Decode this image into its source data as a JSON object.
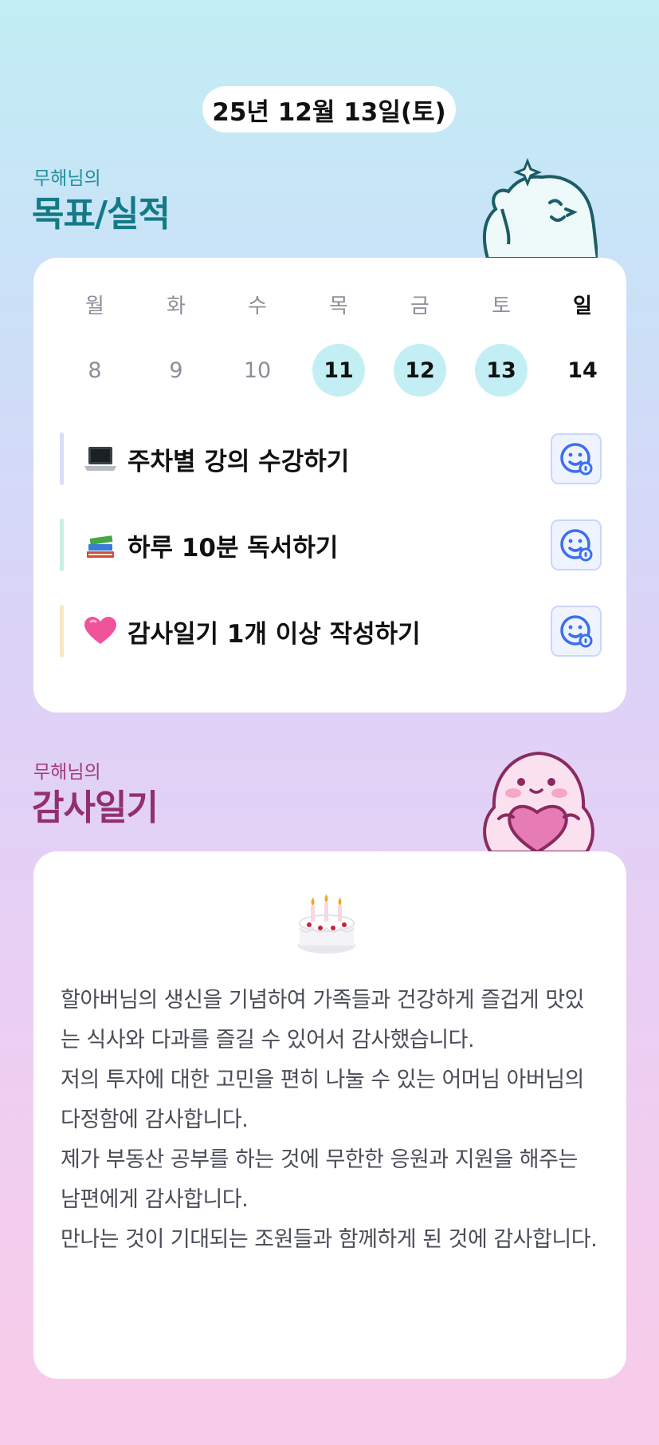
{
  "date_label": "25년 12월 13일(토)",
  "goals_section": {
    "subtitle": "무해님의",
    "title": "목표/실적"
  },
  "week": {
    "days": [
      "월",
      "화",
      "수",
      "목",
      "금",
      "토",
      "일"
    ],
    "dates": [
      "8",
      "9",
      "10",
      "11",
      "12",
      "13",
      "14"
    ],
    "completed": [
      false,
      false,
      false,
      true,
      true,
      true,
      false
    ],
    "today_index": 6
  },
  "goals": [
    {
      "emoji": "laptop-icon",
      "label": "주차별 강의 수강하기",
      "accent": "#d8defa"
    },
    {
      "emoji": "books-icon",
      "label": "하루 10분 독서하기",
      "accent": "#c8f0de"
    },
    {
      "emoji": "pink-heart-icon",
      "label": "감사일기 1개 이상 작성하기",
      "accent": "#fae7c4"
    }
  ],
  "gratitude_section": {
    "subtitle": "무해님의",
    "title": "감사일기"
  },
  "diary": {
    "emoji": "birthday-cake-icon",
    "lines": [
      "할아버님의 생신을 기념하여 가족들과 건강하게 즐겁게 맛있는 식사와 다과를 즐길 수 있어서 감사했습니다.",
      "저의 투자에 대한 고민을 편히 나눌 수 있는 어머님 아버님의 다정함에 감사합니다.",
      "제가 부동산 공부를 하는 것에 무한한 응원과 지원을 해주는 남편에게 감사합니다.",
      "만나는 것이 기대되는 조원들과 함께하게 된 것에 감사합니다."
    ]
  },
  "colors": {
    "goal_title": "#137a86",
    "gratitude_title": "#92306b",
    "done_circle": "#c3eff4",
    "face_icon": "#3b6ef0"
  }
}
